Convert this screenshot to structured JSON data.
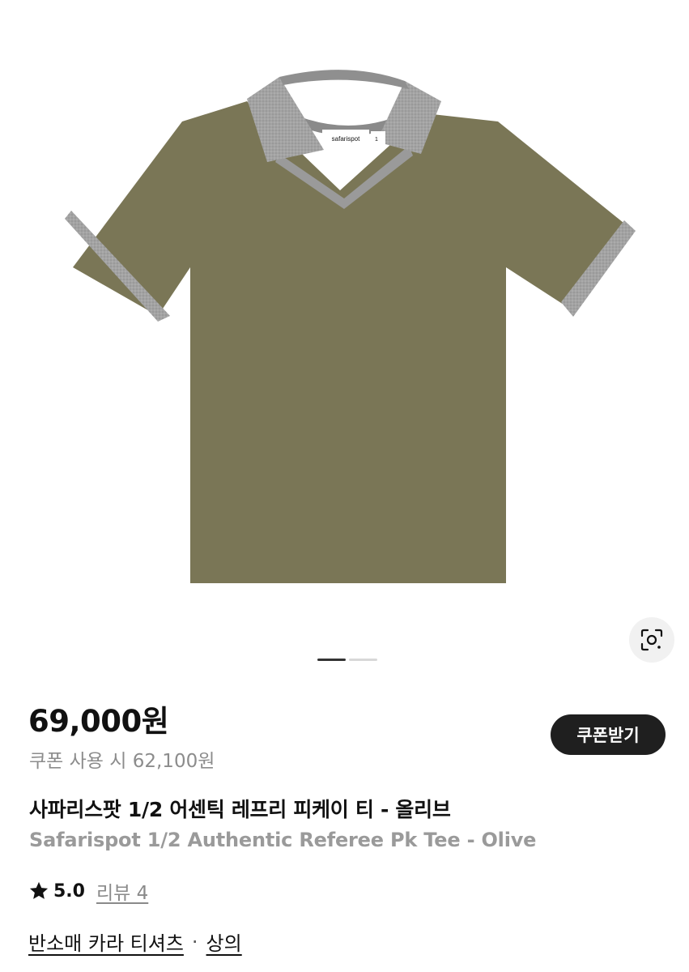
{
  "product": {
    "image_label_brand": "safarispot",
    "image_label_size": "1",
    "slide_count": 2,
    "active_slide": 1
  },
  "price": {
    "main": "69,000원",
    "coupon": "쿠폰 사용 시 62,100원",
    "coupon_button": "쿠폰받기"
  },
  "title": {
    "korean": "사파리스팟 1/2 어센틱 레프리 피케이 티 - 올리브",
    "english": "Safarispot 1/2 Authentic Referee Pk Tee - Olive"
  },
  "rating": {
    "value": "5.0",
    "reviews": "리뷰 4"
  },
  "category": {
    "primary": "반소매 카라 티셔츠",
    "separator": "·",
    "secondary": "상의"
  },
  "colors": {
    "shirt": "#7a7656",
    "trim": "#9e9e9e",
    "coupon_button": "#1f1f1f"
  },
  "icons": {
    "lens": "image-search-icon",
    "rating": "star-icon"
  }
}
